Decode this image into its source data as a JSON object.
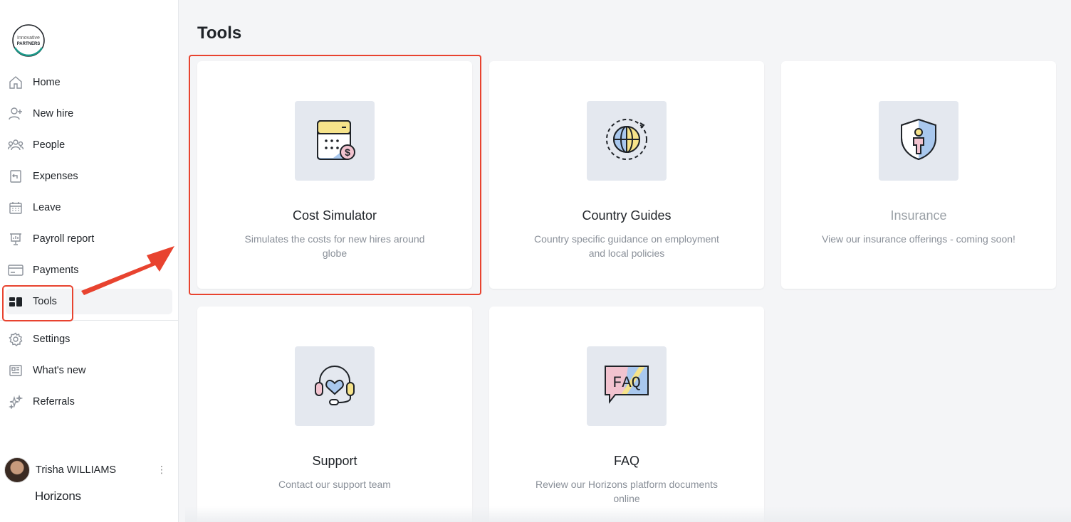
{
  "logo": {
    "line1": "Innovative",
    "line2": "PARTNERS"
  },
  "sidebar": {
    "items": [
      {
        "label": "Home",
        "icon": "home-icon"
      },
      {
        "label": "New hire",
        "icon": "user-plus-icon"
      },
      {
        "label": "People",
        "icon": "people-icon"
      },
      {
        "label": "Expenses",
        "icon": "receipt-icon"
      },
      {
        "label": "Leave",
        "icon": "calendar-icon"
      },
      {
        "label": "Payroll report",
        "icon": "report-icon"
      },
      {
        "label": "Payments",
        "icon": "credit-card-icon"
      },
      {
        "label": "Tools",
        "icon": "tools-grid-icon",
        "active": true
      }
    ],
    "secondary": [
      {
        "label": "Settings",
        "icon": "gear-icon"
      },
      {
        "label": "What's new",
        "icon": "newspaper-icon"
      },
      {
        "label": "Referrals",
        "icon": "sparkles-icon"
      }
    ]
  },
  "user": {
    "name": "Trisha WILLIAMS",
    "menu": "⋮"
  },
  "brand": "Horizons",
  "page": {
    "title": "Tools"
  },
  "tools": [
    {
      "title": "Cost Simulator",
      "desc": "Simulates the costs for new hires around globe",
      "icon": "calculator-dollar-icon"
    },
    {
      "title": "Country Guides",
      "desc": "Country specific guidance on employment and local policies",
      "icon": "globe-icon"
    },
    {
      "title": "Insurance",
      "desc": "View our insurance offerings - coming soon!",
      "icon": "shield-person-icon",
      "disabled": true
    },
    {
      "title": "Support",
      "desc": "Contact our support team",
      "icon": "headset-heart-icon"
    },
    {
      "title": "FAQ",
      "desc": "Review our Horizons platform documents online",
      "icon": "faq-bubble-icon"
    }
  ],
  "colors": {
    "accent_highlight": "#e8432f",
    "page_bg": "#f4f5f7",
    "thumb_bg": "#e4e8ef"
  }
}
